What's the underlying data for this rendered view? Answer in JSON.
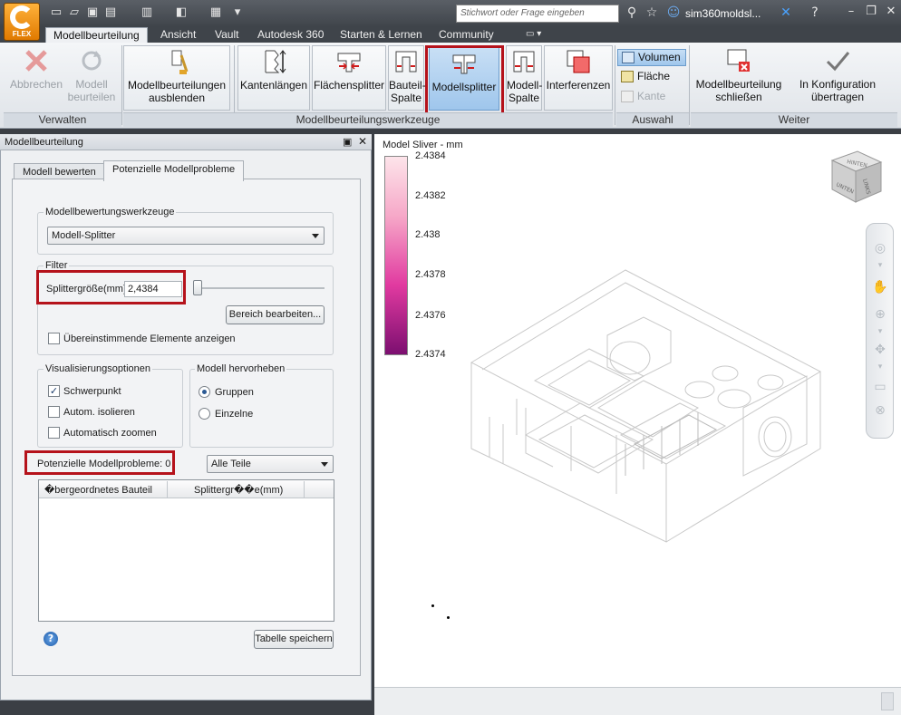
{
  "app": {
    "logo_text": "FLEX"
  },
  "titlebar": {
    "search_placeholder": "Stichwort oder Frage eingeben",
    "user_name": "sim360moldsl...",
    "icons": [
      "new-icon",
      "open-icon",
      "save-icon",
      "save-as-icon",
      "project-icon",
      "view-icon",
      "settings-icon",
      "dropdown-icon",
      "binoculars-icon",
      "star-icon",
      "user-icon",
      "x-icon",
      "help-icon",
      "minimize-icon",
      "restore-icon",
      "close-icon"
    ]
  },
  "tabs": [
    {
      "label": "Modellbeurteilung",
      "active": true
    },
    {
      "label": "Ansicht"
    },
    {
      "label": "Vault"
    },
    {
      "label": "Autodesk 360"
    },
    {
      "label": "Starten & Lernen"
    },
    {
      "label": "Community"
    }
  ],
  "ribbon": {
    "verwalten": {
      "label": "Verwalten",
      "cancel_label": "Abbrechen",
      "split_label_1": "Modell",
      "split_label_2": "beurteilen"
    },
    "hide_label_1": "Modellbeurteilungen",
    "hide_label_2": "ausblenden",
    "tools": {
      "label": "Modellbeurteilungswerkzeuge",
      "edge_lengths": "Kantenlängen",
      "face_splitter": "Flächensplitter",
      "part_gap_1": "Bauteil-",
      "part_gap_2": "Spalte",
      "model_splitter": "Modellsplitter",
      "model_gap_1": "Modell-",
      "model_gap_2": "Spalte",
      "interferences": "Interferenzen"
    },
    "selection": {
      "label": "Auswahl",
      "volume": "Volumen",
      "face": "Fläche",
      "edge": "Kante"
    },
    "further": {
      "label": "Weiter",
      "close_1": "Modellbeurteilung",
      "close_2": "schließen",
      "transfer_1": "In Konfiguration",
      "transfer_2": "übertragen"
    }
  },
  "panel": {
    "title": "Modellbeurteilung",
    "tabs": [
      "Modell bewerten",
      "Potenzielle Modellprobleme"
    ],
    "tools_legend": "Modellbewertungswerkzeuge",
    "tool_selected": "Modell-Splitter",
    "filter_legend": "Filter",
    "splitter_label": "Splittergröße(mm)",
    "splitter_value": "2,4384",
    "edit_range": "Bereich bearbeiten...",
    "matching_elements": "Übereinstimmende Elemente anzeigen",
    "vis_legend": "Visualisierungsoptionen",
    "vis_options": [
      {
        "label": "Schwerpunkt",
        "checked": true
      },
      {
        "label": "Autom. isolieren",
        "checked": false
      },
      {
        "label": "Automatisch zoomen",
        "checked": false
      }
    ],
    "highlight_legend": "Modell hervorheben",
    "highlight_options": [
      {
        "label": "Gruppen",
        "selected": true
      },
      {
        "label": "Einzelne",
        "selected": false
      }
    ],
    "issues_label": "Potenzielle Modellprobleme: 0",
    "parts_filter": "Alle Teile",
    "table_headers": [
      "�bergeordnetes Bauteil",
      "Splittergr��e(mm)"
    ],
    "save_table": "Tabelle speichern"
  },
  "viewport": {
    "legend_title": "Model Sliver - mm",
    "legend_ticks": [
      "2.4384",
      "2.4382",
      "2.438",
      "2.4378",
      "2.4376",
      "2.4374"
    ],
    "viewcube": {
      "top": "HINTEN",
      "right": "LINKS",
      "front": "UNTEN"
    }
  }
}
